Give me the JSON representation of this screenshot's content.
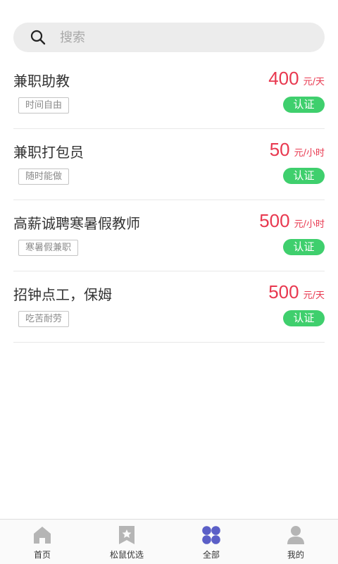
{
  "search": {
    "placeholder": "搜索",
    "icon": "search-icon"
  },
  "jobs": [
    {
      "title": "兼职助教",
      "tag": "时间自由",
      "amount": "400",
      "unit": "元/天",
      "badge": "认证"
    },
    {
      "title": "兼职打包员",
      "tag": "随时能做",
      "amount": "50",
      "unit": "元/小时",
      "badge": "认证"
    },
    {
      "title": "高薪诚聘寒暑假教师",
      "tag": "寒暑假兼职",
      "amount": "500",
      "unit": "元/小时",
      "badge": "认证"
    },
    {
      "title": "招钟点工，保姆",
      "tag": "吃苦耐劳",
      "amount": "500",
      "unit": "元/天",
      "badge": "认证"
    }
  ],
  "tabbar": {
    "tabs": [
      {
        "label": "首页",
        "icon": "home-icon"
      },
      {
        "label": "松鼠优选",
        "icon": "star-bookmark-icon"
      },
      {
        "label": "全部",
        "icon": "grid-icon",
        "active": true
      },
      {
        "label": "我的",
        "icon": "user-icon"
      }
    ]
  },
  "colors": {
    "salary": "#e8384f",
    "badge": "#3fcf6d",
    "active_tab_icon": "#5b5fc7",
    "inactive_tab_icon": "#b5b5b5"
  }
}
